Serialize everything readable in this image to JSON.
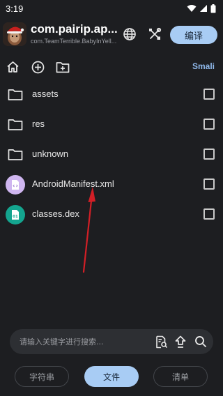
{
  "status_bar": {
    "time": "3:19",
    "icons": [
      "wifi-icon",
      "signal-icon",
      "battery-icon"
    ]
  },
  "header": {
    "app_title": "com.pairip.ap...",
    "app_subtitle": "com.TeamTerrible.BabyInYell...",
    "compile_label": "编译",
    "icons": [
      "globe-icon",
      "tools-icon"
    ]
  },
  "toolbar": {
    "icons": [
      "home-icon",
      "add-circle-icon",
      "new-folder-icon"
    ],
    "smali_label": "Smali"
  },
  "files": [
    {
      "name": "assets",
      "icon": "folder-icon"
    },
    {
      "name": "res",
      "icon": "folder-icon"
    },
    {
      "name": "unknown",
      "icon": "folder-icon"
    },
    {
      "name": "AndroidManifest.xml",
      "icon": "xml-file-icon"
    },
    {
      "name": "classes.dex",
      "icon": "dex-file-icon"
    }
  ],
  "search": {
    "placeholder": "请输入关键字进行搜索..."
  },
  "tabs": [
    {
      "label": "字符串",
      "active": false
    },
    {
      "label": "文件",
      "active": true
    },
    {
      "label": "清单",
      "active": false
    }
  ],
  "colors": {
    "background": "#1d1e21",
    "accent": "#a8ccf4",
    "link": "#8fb8ea",
    "xml_icon_bg": "#cfb6f0",
    "dex_icon_bg": "#14a58f",
    "annotation": "#d21f26"
  }
}
